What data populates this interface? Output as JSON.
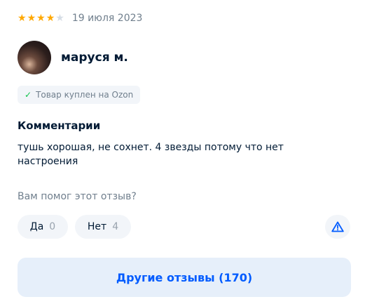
{
  "review": {
    "rating": 4,
    "rating_max": 5,
    "date": "19 июля 2023",
    "author": "маруся м.",
    "verified_label": "Товар куплен на Ozon",
    "comment_label": "Комментарии",
    "comment_text": "тушь хорошая, не сохнет. 4 звезды потому что нет настроения",
    "helpful_question": "Вам помог этот отзыв?",
    "votes": {
      "yes_label": "Да",
      "yes_count": "0",
      "no_label": "Нет",
      "no_count": "4"
    },
    "report_icon": "warning-triangle-icon",
    "other_reviews_label": "Другие отзывы (170)"
  },
  "colors": {
    "star_filled": "#ffa800",
    "star_empty": "#d6dde5",
    "accent": "#005bff",
    "verified_check": "#10c44c",
    "button_bg": "#f2f5f9",
    "primary_button_bg": "#e6effa"
  }
}
